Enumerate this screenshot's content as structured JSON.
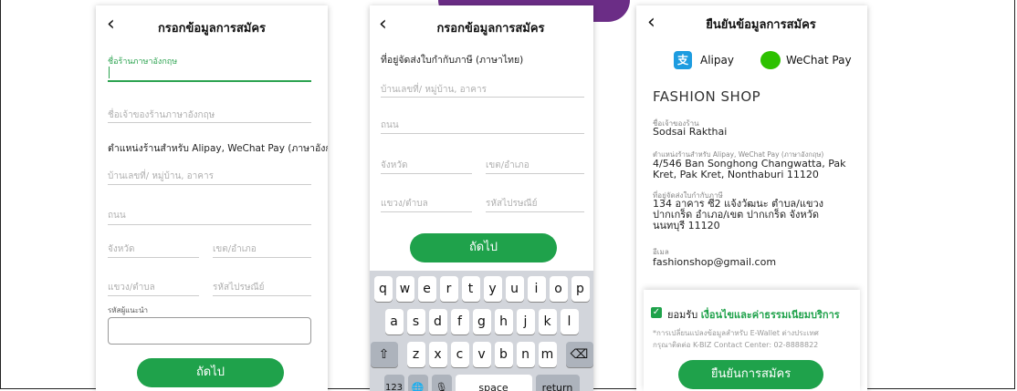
{
  "screen1": {
    "title": "กรอกข้อมูลการสมัคร",
    "field_shop_name_en": "ชื่อร้านภาษาอังกฤษ",
    "ph_owner_name": "ชื่อเจ้าของร้านภาษาอังกฤษ",
    "section_address": "ตำแหน่งร้านสำหรับ Alipay, WeChat Pay (ภาษาอังกฤ",
    "ph_house": "บ้านเลขที่/ หมู่บ้าน, อาคาร",
    "ph_road": "ถนน",
    "ph_province": "จังหวัด",
    "ph_district": "เขต/อำเภอ",
    "ph_subdistrict": "แขวง/ตำบล",
    "ph_postcode": "รหัสไปรษณีย์",
    "label_referral": "รหัสผู้แนะนำ",
    "next_button": "ถัดไป"
  },
  "screen2": {
    "title": "กรอกข้อมูลการสมัคร",
    "section_tax_address": "ที่อยู่จัดส่งใบกำกับภาษี (ภาษาไทย)",
    "ph_house": "บ้านเลขที่/ หมู่บ้าน, อาคาร",
    "ph_road": "ถนน",
    "ph_province": "จังหวัด",
    "ph_district": "เขต/อำเภอ",
    "ph_subdistrict": "แขวง/ตำบล",
    "ph_postcode": "รหัสไปรษณีย์",
    "next_button": "ถัดไป",
    "keyboard": {
      "row1": [
        "q",
        "w",
        "e",
        "r",
        "t",
        "y",
        "u",
        "i",
        "o",
        "p"
      ],
      "row2": [
        "a",
        "s",
        "d",
        "f",
        "g",
        "h",
        "j",
        "k",
        "l"
      ],
      "row3": [
        "z",
        "x",
        "c",
        "v",
        "b",
        "n",
        "m"
      ],
      "shift": "⇧",
      "backspace": "⌫",
      "numbers": "123",
      "globe": "🌐",
      "mic": "🎙",
      "space": "space",
      "return": "return"
    }
  },
  "screen3": {
    "title": "ยืนยันข้อมูลการสมัคร",
    "alipay_label": "Alipay",
    "alipay_glyph": "支",
    "wechat_label": "WeChat Pay",
    "shop_name": "FASHION SHOP",
    "label_owner": "ชื่อเจ้าของร้าน",
    "owner_name": "Sodsai Rakthai",
    "label_address_en": "ตำแหน่งร้านสำหรับ Alipay, WeChat Pay (ภาษาอังกฤษ)",
    "address_en": "4/546 Ban Songhong Changwatta, Pak\nKret, Pak Kret, Nonthaburi 11120",
    "label_tax_address": "ที่อยู่จัดส่งใบกำกับภาษี",
    "tax_address": "134 อาคาร ซี2 แจ้งวัฒนะ ตำบล/แขวง\nปากเกร็ด อำเภอ/เขต ปากเกร็ด จังหวัด\nนนทบุรี 11120",
    "label_email": "อีเมล",
    "email": "fashionshop@gmail.com",
    "agree_prefix": "ยอมรับ",
    "agree_terms": "เงื่อนไขและค่าธรรมเนียมบริการ",
    "note": "*การเปลี่ยนแปลงข้อมูลสำหรับ E-Wallet ต่างประเทศ\nกรุณาติดต่อ K-BIZ Contact Center: 02-8888822",
    "confirm_button": "ยืนยันการสมัคร"
  },
  "colors": {
    "accent_green": "#1fa24b",
    "banner_purple": "#6b2d86",
    "alipay_blue": "#1d9ce0",
    "wechat_green": "#2dc100"
  }
}
